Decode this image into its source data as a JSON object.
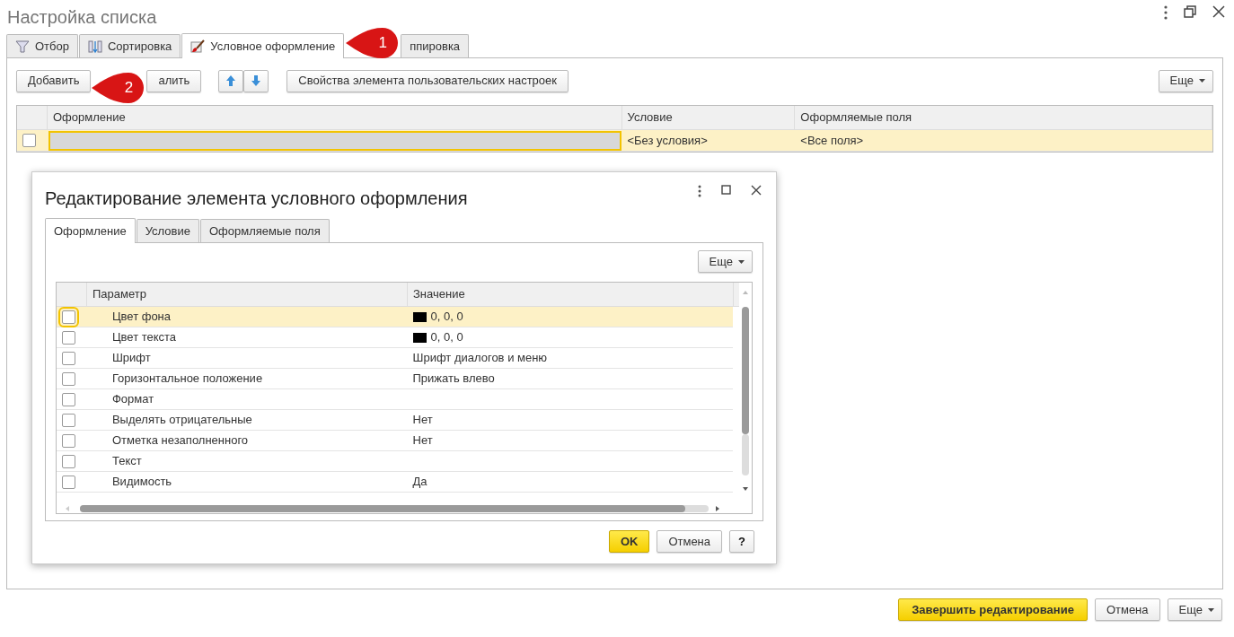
{
  "window": {
    "title": "Настройка списка"
  },
  "tabs": [
    {
      "label": "Отбор",
      "selected": false,
      "kind": "filter"
    },
    {
      "label": "Сортировка",
      "selected": false,
      "kind": "sort"
    },
    {
      "label": "Условное оформление",
      "selected": true,
      "kind": "brush"
    },
    {
      "label": "ппировка",
      "selected": false
    }
  ],
  "toolbar": {
    "buttons": [
      "Добавить",
      "алить"
    ],
    "properties_button": "Свойства элемента пользовательских настроек",
    "more_button": "Еще"
  },
  "table": {
    "columns": [
      "Оформление",
      "Условие",
      "Оформляемые поля"
    ],
    "rows": [
      {
        "checked": false,
        "selected": true,
        "condition": "<Без условия>",
        "fields": "<Все поля>"
      }
    ]
  },
  "callouts": [
    "1",
    "2"
  ],
  "dialog": {
    "title": "Редактирование элемента условного оформления",
    "tabs": [
      {
        "label": "Оформление",
        "selected": true
      },
      {
        "label": "Условие",
        "selected": false
      },
      {
        "label": "Оформляемые поля",
        "selected": false
      }
    ],
    "more_button": "Еще",
    "columns": [
      "Параметр",
      "Значение"
    ],
    "rows": [
      {
        "checked": false,
        "selected": true,
        "parameter": "Цвет фона",
        "kind": "color",
        "color": "#000000",
        "value": "0, 0, 0"
      },
      {
        "checked": false,
        "selected": false,
        "parameter": "Цвет текста",
        "kind": "color",
        "color": "#000000",
        "value": "0, 0, 0"
      },
      {
        "checked": false,
        "selected": false,
        "parameter": "Шрифт",
        "kind": "text",
        "value": "Шрифт диалогов и меню"
      },
      {
        "checked": false,
        "selected": false,
        "parameter": "Горизонтальное положение",
        "kind": "text",
        "value": "Прижать влево"
      },
      {
        "checked": false,
        "selected": false,
        "parameter": "Формат",
        "kind": "text"
      },
      {
        "checked": false,
        "selected": false,
        "parameter": "Выделять отрицательные",
        "kind": "text",
        "value": "Нет"
      },
      {
        "checked": false,
        "selected": false,
        "parameter": "Отметка незаполненного",
        "kind": "text",
        "value": "Нет"
      },
      {
        "checked": false,
        "selected": false,
        "parameter": "Текст",
        "kind": "text"
      },
      {
        "checked": false,
        "selected": false,
        "parameter": "Видимость",
        "kind": "text",
        "value": "Да"
      }
    ],
    "buttons": [
      {
        "label": "OK",
        "kind": "primary"
      },
      {
        "label": "Отмена",
        "kind": "plain"
      },
      {
        "label": "?",
        "kind": "help"
      }
    ]
  },
  "footer": {
    "buttons": [
      {
        "label": "Завершить редактирование",
        "kind": "primary"
      },
      {
        "label": "Отмена",
        "kind": "plain"
      },
      {
        "label": "Еще",
        "kind": "menu"
      }
    ]
  }
}
